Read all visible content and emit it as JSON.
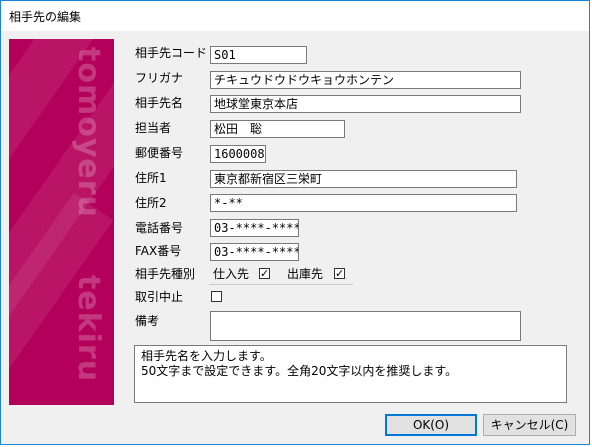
{
  "window": {
    "title": "相手先の編集"
  },
  "banner": {
    "watermark_top": "tomoyeru",
    "watermark_bottom": "tekiru",
    "color": "#b3005a"
  },
  "form": {
    "code_label": "相手先コード",
    "code_value": "S01",
    "furigana_label": "フリガナ",
    "furigana_value": "チキュウドウドウキョウホンテン",
    "name_label": "相手先名",
    "name_value": "地球堂東京本店",
    "person_label": "担当者",
    "person_value": "松田　聡",
    "zip_label": "郵便番号",
    "zip_value": "1600008",
    "addr1_label": "住所1",
    "addr1_value": "東京都新宿区三栄町",
    "addr2_label": "住所2",
    "addr2_value": "*-**",
    "phone_label": "電話番号",
    "phone_value": "03-****-****",
    "fax_label": "FAX番号",
    "fax_value": "03-****-****",
    "type_label": "相手先種別",
    "type_supplier_label": "仕入先",
    "type_supplier_checked": true,
    "type_shipto_label": "出庫先",
    "type_shipto_checked": true,
    "suspend_label": "取引中止",
    "suspend_checked": false,
    "memo_label": "備考",
    "memo_value": ""
  },
  "help": {
    "line1": "相手先名を入力します。",
    "line2": "50文字まで設定できます。全角20文字以内を推奨します。"
  },
  "buttons": {
    "ok_label": "OK(O)",
    "cancel_label": "キャンセル(C)"
  }
}
